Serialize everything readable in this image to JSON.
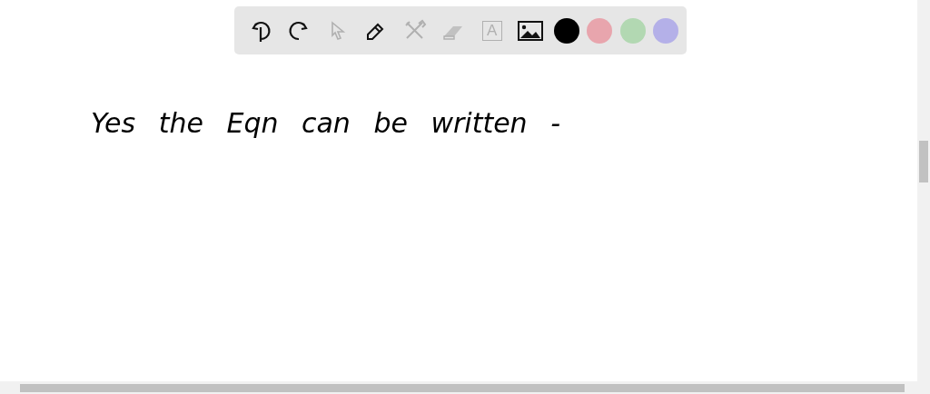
{
  "toolbar": {
    "tools": [
      {
        "kind": "undo",
        "disabled": false
      },
      {
        "kind": "redo",
        "disabled": false
      },
      {
        "kind": "select",
        "disabled": true
      },
      {
        "kind": "pen",
        "disabled": false
      },
      {
        "kind": "tools",
        "disabled": true
      },
      {
        "kind": "eraser",
        "disabled": true
      },
      {
        "kind": "text",
        "label": "A",
        "disabled": true
      },
      {
        "kind": "image",
        "disabled": false
      }
    ],
    "colors": [
      {
        "color": "#000000"
      },
      {
        "color": "#e8a5ad"
      },
      {
        "color": "#b2d8b2"
      },
      {
        "color": "#b4b0e8"
      }
    ]
  },
  "canvas": {
    "handwriting": "Yes the Eqn can be written -"
  }
}
